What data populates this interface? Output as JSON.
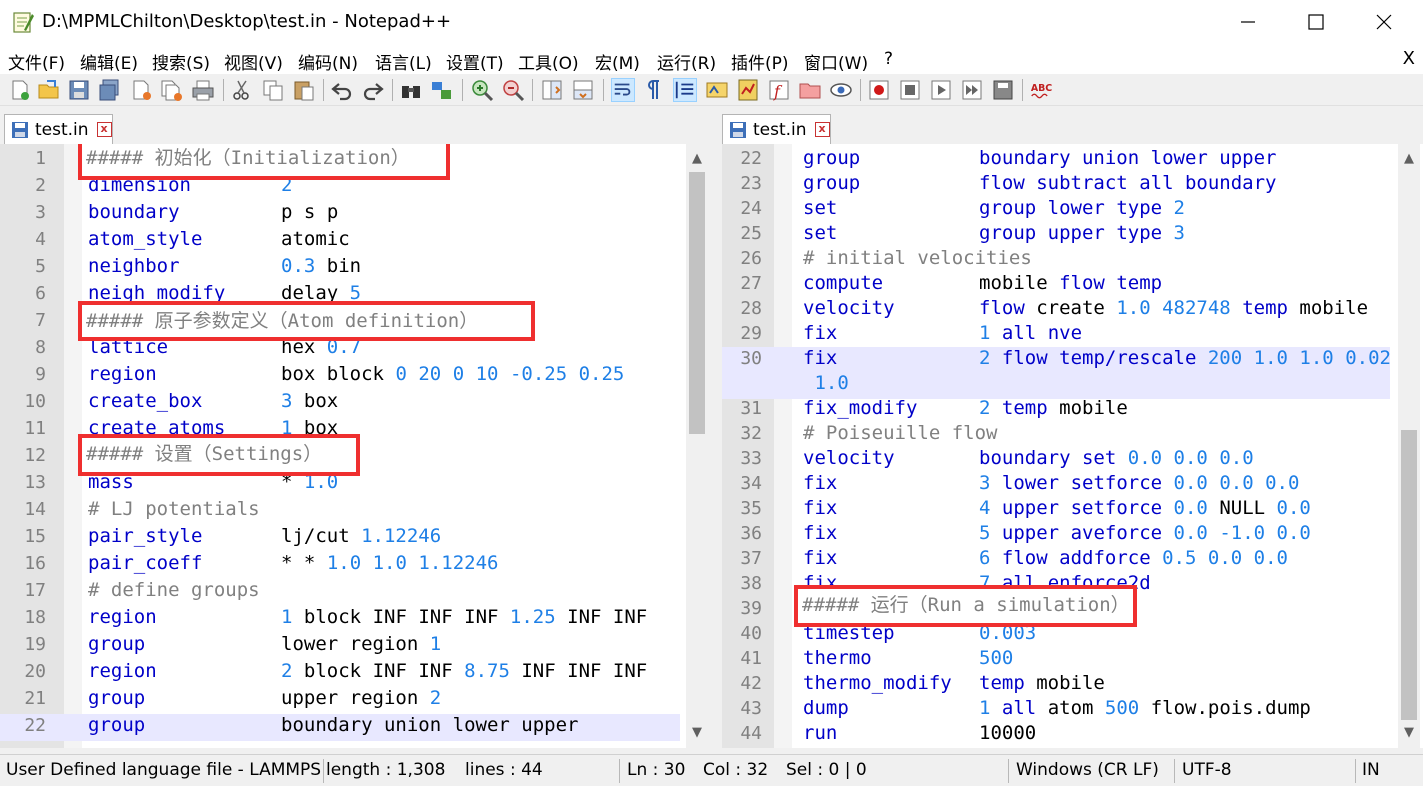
{
  "window": {
    "title": "D:\\MPMLChilton\\Desktop\\test.in - Notepad++"
  },
  "menu": [
    {
      "label": "文件(F)"
    },
    {
      "label": "编辑(E)"
    },
    {
      "label": "搜索(S)"
    },
    {
      "label": "视图(V)"
    },
    {
      "label": "编码(N)"
    },
    {
      "label": "语言(L)"
    },
    {
      "label": "设置(T)"
    },
    {
      "label": "工具(O)"
    },
    {
      "label": "宏(M)"
    },
    {
      "label": "运行(R)"
    },
    {
      "label": "插件(P)"
    },
    {
      "label": "窗口(W)"
    },
    {
      "label": "?"
    }
  ],
  "menu_close": "X",
  "toolbar_icons": [
    "new-file-icon",
    "open-file-icon",
    "save-icon",
    "save-all-icon",
    "close-icon",
    "close-all-icon",
    "print-icon",
    "cut-icon",
    "copy-icon",
    "paste-icon",
    "undo-icon",
    "redo-icon",
    "find-icon",
    "replace-icon",
    "zoom-in-icon",
    "zoom-out-icon",
    "sync-vertical-icon",
    "sync-horizontal-icon",
    "word-wrap-icon",
    "show-all-chars-icon",
    "indent-guide-icon",
    "user-language-icon",
    "doc-map-icon",
    "function-list-icon",
    "folder-workspace-icon",
    "monitoring-icon",
    "record-macro-icon",
    "stop-record-icon",
    "play-macro-icon",
    "run-macro-multiple-icon",
    "save-macro-icon",
    "spell-check-icon"
  ],
  "left_tab": {
    "label": "test.in",
    "close": "x"
  },
  "right_tab": {
    "label": "test.in",
    "close": "x"
  },
  "left_lines": [
    {
      "n": "1",
      "kw": "",
      "arg": ""
    },
    {
      "n": "2",
      "kw": "dimension",
      "arg": "2"
    },
    {
      "n": "3",
      "kw": "boundary",
      "arg": "p s p"
    },
    {
      "n": "4",
      "kw": "atom_style",
      "arg": "atomic"
    },
    {
      "n": "5",
      "kw": "neighbor",
      "arg": "0.3 bin"
    },
    {
      "n": "6",
      "kw": "neigh_modify",
      "arg": "delay 5"
    },
    {
      "n": "7",
      "kw": "",
      "arg": ""
    },
    {
      "n": "8",
      "kw": "lattice",
      "arg": "hex 0.7"
    },
    {
      "n": "9",
      "kw": "region",
      "arg": "box block 0 20 0 10 -0.25 0.25"
    },
    {
      "n": "10",
      "kw": "create_box",
      "arg": "3 box"
    },
    {
      "n": "11",
      "kw": "create_atoms",
      "arg": "1 box"
    },
    {
      "n": "12",
      "kw": "",
      "arg": ""
    },
    {
      "n": "13",
      "kw": "mass",
      "arg": "* 1.0"
    },
    {
      "n": "14",
      "kw": "# LJ potentials",
      "arg": ""
    },
    {
      "n": "15",
      "kw": "pair_style",
      "arg": "lj/cut 1.12246"
    },
    {
      "n": "16",
      "kw": "pair_coeff",
      "arg": "* * 1.0 1.0 1.12246"
    },
    {
      "n": "17",
      "kw": "# define groups",
      "arg": ""
    },
    {
      "n": "18",
      "kw": "region",
      "arg": "1 block INF INF INF 1.25 INF INF"
    },
    {
      "n": "19",
      "kw": "group",
      "arg": "lower region 1"
    },
    {
      "n": "20",
      "kw": "region",
      "arg": "2 block INF INF 8.75 INF INF INF"
    },
    {
      "n": "21",
      "kw": "group",
      "arg": "upper region 2"
    },
    {
      "n": "22",
      "kw": "group",
      "arg": "boundary union lower upper"
    }
  ],
  "right_lines": [
    {
      "n": "22",
      "kw": "group",
      "arg": "boundary union lower upper"
    },
    {
      "n": "23",
      "kw": "group",
      "arg": "flow subtract all boundary"
    },
    {
      "n": "24",
      "kw": "set",
      "arg": "group lower type 2"
    },
    {
      "n": "25",
      "kw": "set",
      "arg": "group upper type 3"
    },
    {
      "n": "26",
      "kw": "# initial velocities",
      "arg": ""
    },
    {
      "n": "27",
      "kw": "compute",
      "arg": "mobile flow temp"
    },
    {
      "n": "28",
      "kw": "velocity",
      "arg": "flow create 1.0 482748 temp mobile"
    },
    {
      "n": "29",
      "kw": "fix",
      "arg": "1 all nve"
    },
    {
      "n": "30",
      "kw": "fix",
      "arg": "2 flow temp/rescale 200 1.0 1.0 0.02"
    },
    {
      "n": "",
      "kw": "",
      "arg": " 1.0"
    },
    {
      "n": "31",
      "kw": "fix_modify",
      "arg": "2 temp mobile"
    },
    {
      "n": "32",
      "kw": "# Poiseuille flow",
      "arg": ""
    },
    {
      "n": "33",
      "kw": "velocity",
      "arg": "boundary set 0.0 0.0 0.0"
    },
    {
      "n": "34",
      "kw": "fix",
      "arg": "3 lower setforce 0.0 0.0 0.0"
    },
    {
      "n": "35",
      "kw": "fix",
      "arg": "4 upper setforce 0.0 NULL 0.0"
    },
    {
      "n": "36",
      "kw": "fix",
      "arg": "5 upper aveforce 0.0 -1.0 0.0"
    },
    {
      "n": "37",
      "kw": "fix",
      "arg": "6 flow addforce 0.5 0.0 0.0"
    },
    {
      "n": "38",
      "kw": "fix",
      "arg": "7 all enforce2d"
    },
    {
      "n": "39",
      "kw": "",
      "arg": ""
    },
    {
      "n": "40",
      "kw": "timestep",
      "arg": "0.003"
    },
    {
      "n": "41",
      "kw": "thermo",
      "arg": "500"
    },
    {
      "n": "42",
      "kw": "thermo_modify",
      "arg": "temp mobile"
    },
    {
      "n": "43",
      "kw": "dump",
      "arg": "1 all atom 500 flow.pois.dump"
    },
    {
      "n": "44",
      "kw": "run",
      "arg": "10000"
    }
  ],
  "highlights": {
    "init": "##### 初始化（Initialization）",
    "atom": "##### 原子参数定义（Atom definition）",
    "settings": "##### 设置（Settings）",
    "run": "##### 运行（Run a simulation）"
  },
  "status": {
    "lang": "User Defined language file - LAMMPS",
    "length": "length : 1,308",
    "lines": "lines : 44",
    "ln": "Ln : 30",
    "col": "Col : 32",
    "sel": "Sel : 0 | 0",
    "eol": "Windows (CR LF)",
    "enc": "UTF-8",
    "ins": "INS"
  },
  "colors": {
    "highlight_border": "#ef2f2f",
    "keyword": "#0000c8",
    "number": "#1e7fe6",
    "comment": "#808080",
    "current_line": "#e8e8ff"
  }
}
